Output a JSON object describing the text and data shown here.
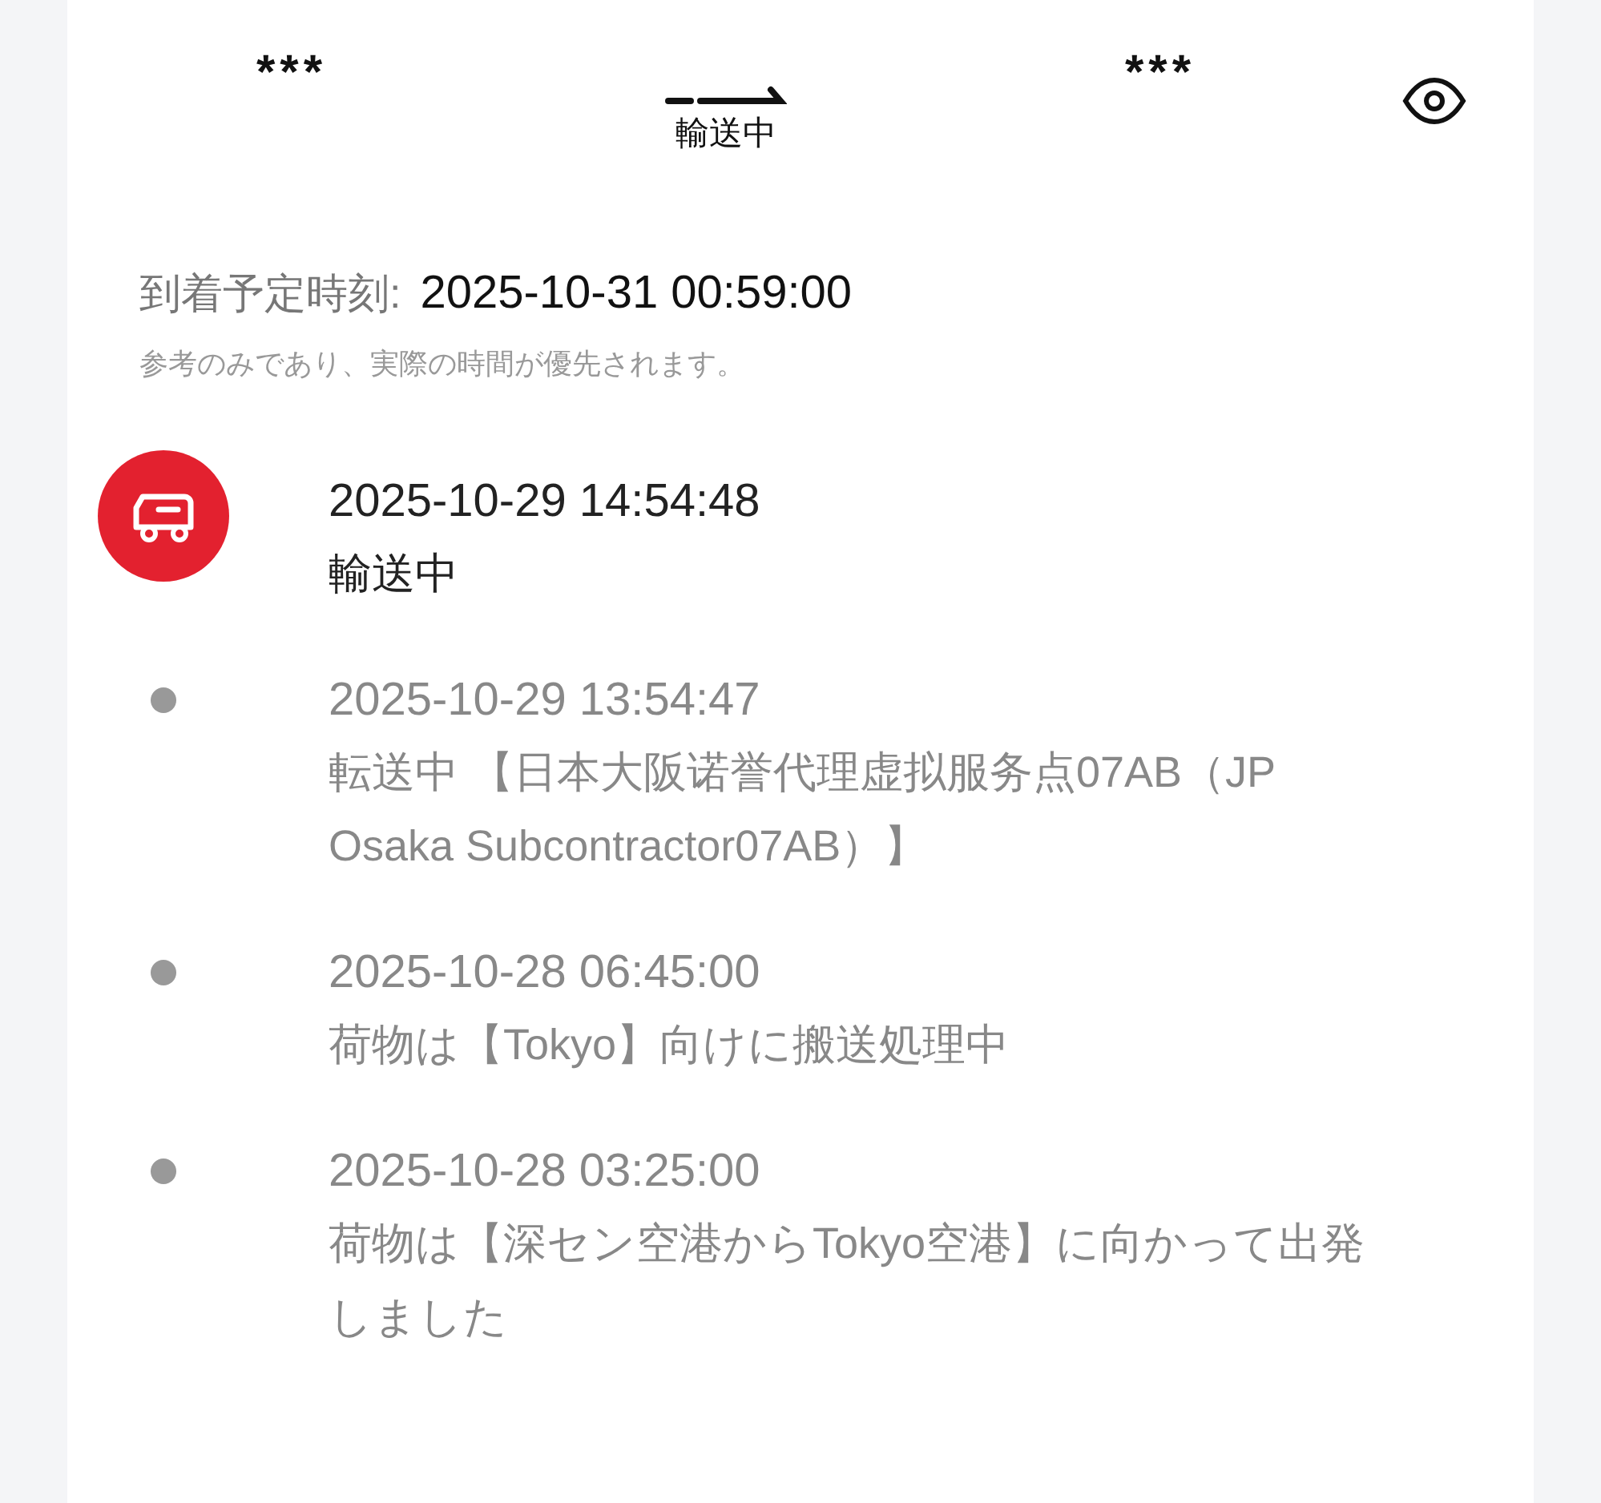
{
  "route": {
    "origin": "***",
    "status": "輸送中",
    "destination": "***"
  },
  "eta": {
    "label": "到着予定時刻:",
    "value": "2025-10-31 00:59:00",
    "note": "参考のみであり、実際の時間が優先されます。"
  },
  "events": [
    {
      "kind": "current",
      "time": "2025-10-29 14:54:48",
      "text": "輸送中"
    },
    {
      "kind": "past",
      "time": "2025-10-29 13:54:47",
      "text": "転送中 【日本大阪诺誉代理虚拟服务点07AB（JP Osaka Subcontractor07AB）】"
    },
    {
      "kind": "past",
      "time": "2025-10-28 06:45:00",
      "text": "荷物は【Tokyo】向けに搬送処理中"
    },
    {
      "kind": "past",
      "time": "2025-10-28 03:25:00",
      "text": "荷物は【深セン空港からTokyo空港】に向かって出発しました"
    }
  ]
}
